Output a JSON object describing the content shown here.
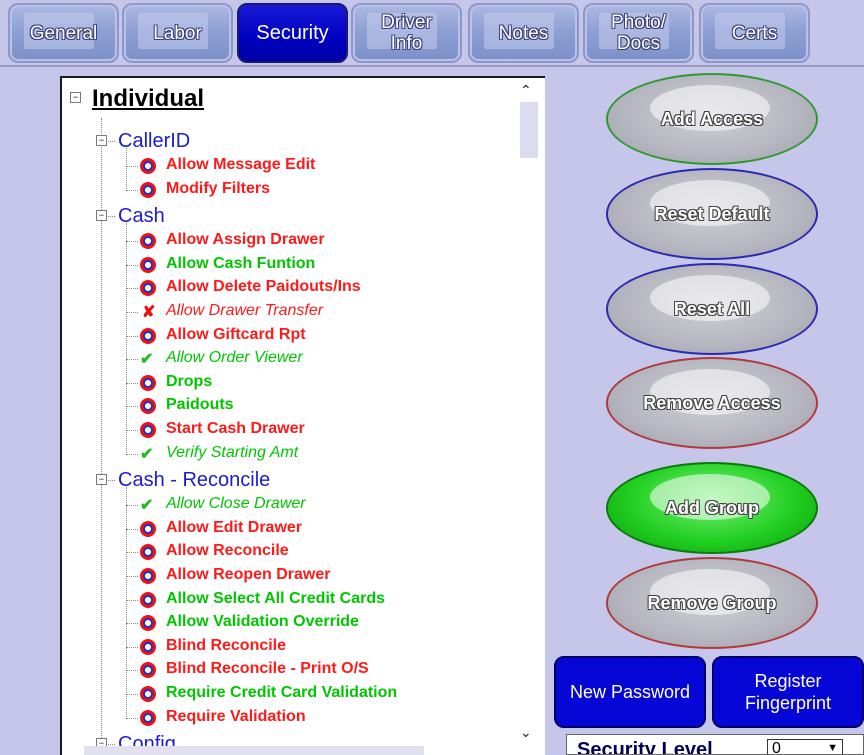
{
  "tabs": [
    {
      "label": "General",
      "active": false
    },
    {
      "label": "Labor",
      "active": false
    },
    {
      "label": "Security",
      "active": true
    },
    {
      "label": "Driver\nInfo",
      "active": false
    },
    {
      "label": "Notes",
      "active": false
    },
    {
      "label": "Photo/\nDocs",
      "active": false
    },
    {
      "label": "Certs",
      "active": false
    }
  ],
  "tree": {
    "root": "Individual",
    "groups": [
      {
        "label": "CallerID",
        "items": [
          {
            "label": "Allow Message Edit",
            "color": "red",
            "status": "icon"
          },
          {
            "label": "Modify Filters",
            "color": "red",
            "status": "icon"
          }
        ]
      },
      {
        "label": "Cash",
        "items": [
          {
            "label": "Allow Assign Drawer",
            "color": "red",
            "status": "icon"
          },
          {
            "label": "Allow Cash Funtion",
            "color": "green",
            "status": "icon"
          },
          {
            "label": "Allow Delete Paidouts/Ins",
            "color": "red",
            "status": "icon"
          },
          {
            "label": "Allow Drawer Transfer",
            "color": "red",
            "status": "denied"
          },
          {
            "label": "Allow Giftcard Rpt",
            "color": "red",
            "status": "icon"
          },
          {
            "label": "Allow Order Viewer",
            "color": "green",
            "status": "granted"
          },
          {
            "label": "Drops",
            "color": "green",
            "status": "icon"
          },
          {
            "label": "Paidouts",
            "color": "green",
            "status": "icon"
          },
          {
            "label": "Start Cash Drawer",
            "color": "red",
            "status": "icon"
          },
          {
            "label": "Verify Starting Amt",
            "color": "green",
            "status": "granted"
          }
        ]
      },
      {
        "label": "Cash - Reconcile",
        "items": [
          {
            "label": "Allow Close Drawer",
            "color": "green",
            "status": "granted"
          },
          {
            "label": "Allow Edit Drawer",
            "color": "red",
            "status": "icon"
          },
          {
            "label": "Allow Reconcile",
            "color": "red",
            "status": "icon"
          },
          {
            "label": "Allow Reopen Drawer",
            "color": "red",
            "status": "icon"
          },
          {
            "label": "Allow Select All Credit Cards",
            "color": "green",
            "status": "icon"
          },
          {
            "label": "Allow Validation Override",
            "color": "green",
            "status": "icon"
          },
          {
            "label": "Blind Reconcile",
            "color": "red",
            "status": "icon"
          },
          {
            "label": "Blind Reconcile - Print O/S",
            "color": "red",
            "status": "icon"
          },
          {
            "label": "Require Credit Card Validation",
            "color": "green",
            "status": "icon"
          },
          {
            "label": "Require Validation",
            "color": "red",
            "status": "icon"
          }
        ]
      },
      {
        "label": "Config",
        "items": []
      }
    ]
  },
  "actions": {
    "add_access": "Add Access",
    "reset_default": "Reset Default",
    "reset_all": "Reset All",
    "remove_access": "Remove Access",
    "add_group": "Add Group",
    "remove_group": "Remove Group",
    "new_password": "New Password",
    "register_fingerprint": "Register\nFingerprint"
  },
  "security_level": {
    "label": "Security Level",
    "value": "0"
  },
  "colors": {
    "tree_red": "#ff1a1a",
    "tree_green": "#00c600",
    "group_blue": "#1b1bd6",
    "active_tab": "#0000c0"
  }
}
